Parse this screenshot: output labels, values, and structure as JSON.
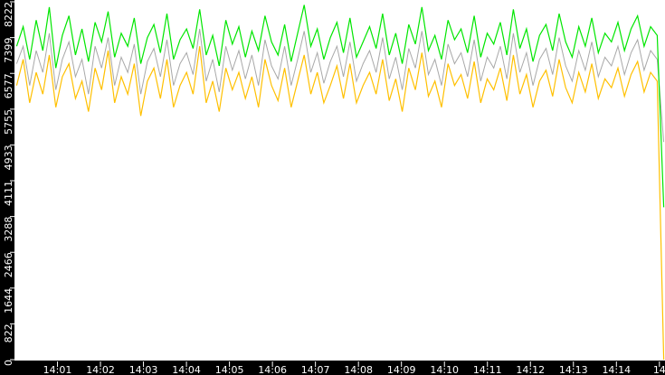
{
  "chart_data": {
    "type": "line",
    "title": "",
    "xlabel": "",
    "ylabel": "",
    "x_unit": "minutes after 14:00",
    "xlim": [
      0.0,
      15.13
    ],
    "ylim": [
      0,
      8300
    ],
    "grid": false,
    "legend": "none",
    "y_ticks": [
      {
        "value": 0,
        "label": "0"
      },
      {
        "value": 822,
        "label": "822"
      },
      {
        "value": 1644,
        "label": "1644"
      },
      {
        "value": 2466,
        "label": "2466"
      },
      {
        "value": 3288,
        "label": "3288"
      },
      {
        "value": 4111,
        "label": "4111"
      },
      {
        "value": 4933,
        "label": "4933"
      },
      {
        "value": 5755,
        "label": "5755"
      },
      {
        "value": 6577,
        "label": "6577"
      },
      {
        "value": 7399,
        "label": "7399"
      },
      {
        "value": 8222,
        "label": "8222"
      }
    ],
    "x_ticks": [
      {
        "value": 1,
        "label": "14:01"
      },
      {
        "value": 2,
        "label": "14:02"
      },
      {
        "value": 3,
        "label": "14:03"
      },
      {
        "value": 4,
        "label": "14:04"
      },
      {
        "value": 5,
        "label": "14:05"
      },
      {
        "value": 6,
        "label": "14:06"
      },
      {
        "value": 7,
        "label": "14:07"
      },
      {
        "value": 8,
        "label": "14:08"
      },
      {
        "value": 9,
        "label": "14:09"
      },
      {
        "value": 10,
        "label": "14:10"
      },
      {
        "value": 11,
        "label": "14:11"
      },
      {
        "value": 12,
        "label": "14:12"
      },
      {
        "value": 13,
        "label": "14:13"
      },
      {
        "value": 14,
        "label": "14:14"
      },
      {
        "value": 15,
        "label": "14"
      }
    ],
    "x_start": 0.05,
    "x_end": 15.1,
    "series": [
      {
        "name": "gray",
        "color": "#a8a8a8",
        "values": [
          6800,
          7200,
          6300,
          7100,
          6600,
          7500,
          6200,
          6900,
          7300,
          6500,
          6900,
          6100,
          7200,
          6700,
          7400,
          6300,
          6950,
          6600,
          7250,
          6100,
          6850,
          7150,
          6500,
          7350,
          6300,
          6800,
          7050,
          6550,
          7600,
          6400,
          6900,
          6150,
          7200,
          6650,
          7100,
          6450,
          7000,
          6300,
          7350,
          6750,
          6450,
          7200,
          6300,
          6900,
          7550,
          6600,
          7050,
          6350,
          6850,
          7200,
          6500,
          7300,
          6400,
          6800,
          7100,
          6600,
          7400,
          6450,
          6950,
          6200,
          7150,
          6700,
          7550,
          6550,
          6900,
          6300,
          7250,
          6800,
          7050,
          6500,
          7350,
          6400,
          6950,
          6700,
          7200,
          6450,
          7500,
          6600,
          7050,
          6300,
          6900,
          7150,
          6550,
          7400,
          6750,
          6400,
          7100,
          6650,
          7300,
          6500,
          6950,
          6750,
          7200,
          6550,
          7050,
          7350,
          6650,
          7100,
          6900,
          5000
        ]
      },
      {
        "name": "yellow",
        "color": "#ffc000",
        "values": [
          6300,
          6900,
          5900,
          6600,
          6100,
          7000,
          5800,
          6500,
          6800,
          6000,
          6400,
          5700,
          6700,
          6200,
          7100,
          5900,
          6500,
          6100,
          6800,
          5600,
          6400,
          6700,
          6000,
          6900,
          5800,
          6300,
          6600,
          6100,
          7200,
          5900,
          6400,
          5700,
          6700,
          6200,
          6600,
          6000,
          6500,
          5800,
          6900,
          6300,
          5950,
          6700,
          5800,
          6400,
          7000,
          6100,
          6600,
          5900,
          6300,
          6750,
          6000,
          6800,
          5900,
          6300,
          6600,
          6100,
          6900,
          5950,
          6450,
          5700,
          6700,
          6200,
          7050,
          6050,
          6400,
          5800,
          6800,
          6300,
          6550,
          6000,
          6850,
          5900,
          6450,
          6200,
          6700,
          5950,
          7000,
          6100,
          6550,
          5800,
          6400,
          6650,
          6050,
          6900,
          6250,
          5900,
          6600,
          6150,
          6800,
          6000,
          6450,
          6250,
          6700,
          6050,
          6550,
          6850,
          6150,
          6600,
          6400,
          0
        ]
      },
      {
        "name": "green",
        "color": "#00e600",
        "values": [
          7200,
          7650,
          6900,
          7800,
          7100,
          8100,
          6700,
          7450,
          7900,
          7000,
          7600,
          6850,
          7750,
          7300,
          8000,
          6950,
          7500,
          7200,
          7850,
          6800,
          7400,
          7700,
          7050,
          7950,
          6900,
          7350,
          7600,
          7150,
          8050,
          7000,
          7450,
          6750,
          7800,
          7250,
          7650,
          6950,
          7550,
          7100,
          7900,
          7300,
          7000,
          7700,
          6850,
          7500,
          8150,
          7200,
          7600,
          6900,
          7400,
          7750,
          7050,
          7850,
          6950,
          7300,
          7650,
          7150,
          7950,
          7000,
          7500,
          6800,
          7700,
          7250,
          8100,
          7100,
          7450,
          6900,
          7800,
          7350,
          7600,
          7050,
          7900,
          6950,
          7500,
          7250,
          7750,
          7000,
          8050,
          7150,
          7600,
          6850,
          7450,
          7700,
          7100,
          7950,
          7300,
          6950,
          7650,
          7200,
          7850,
          7050,
          7500,
          7300,
          7750,
          7100,
          7600,
          7900,
          7200,
          7650,
          7450,
          3500
        ]
      }
    ]
  }
}
